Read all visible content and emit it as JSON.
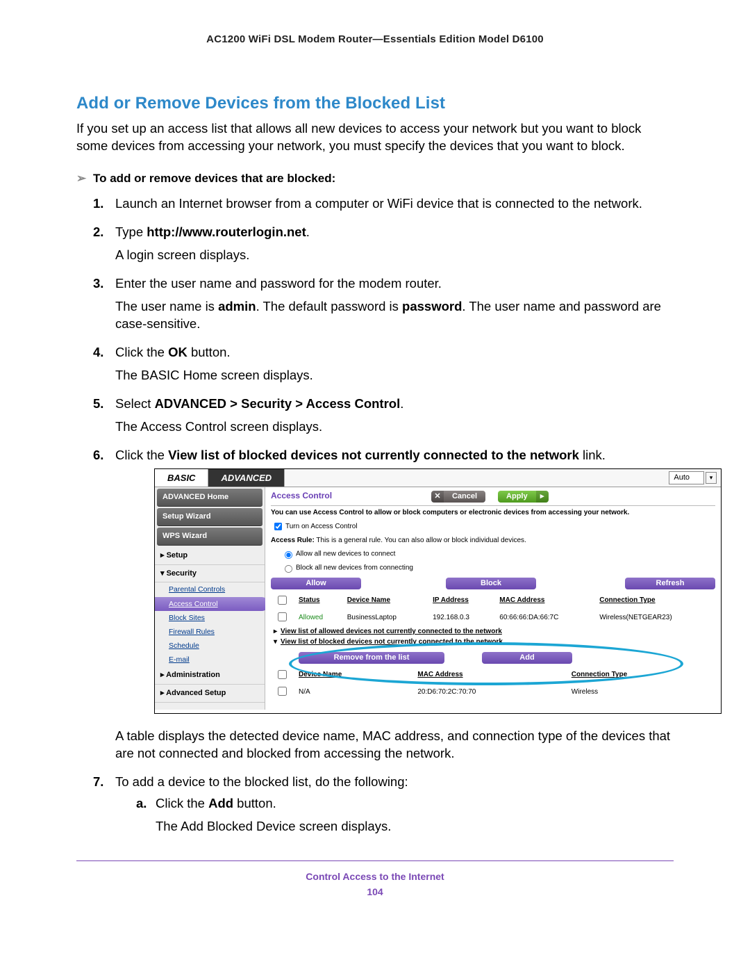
{
  "header": "AC1200 WiFi DSL Modem Router—Essentials Edition Model D6100",
  "section_title": "Add or Remove Devices from the Blocked List",
  "intro": "If you set up an access list that allows all new devices to access your network but you want to block some devices from accessing your network, you must specify the devices that you want to block.",
  "procedure_heading": "To add or remove devices that are blocked:",
  "steps": {
    "s1": "Launch an Internet browser from a computer or WiFi device that is connected to the network.",
    "s2_pre": "Type ",
    "s2_url": "http://www.routerlogin.net",
    "s2_post": ".",
    "s2_sub": "A login screen displays.",
    "s3": "Enter the user name and password for the modem router.",
    "s3_sub_pre": "The user name is ",
    "s3_sub_admin": "admin",
    "s3_sub_mid": ". The default password is ",
    "s3_sub_pw": "password",
    "s3_sub_post": ". The user name and password are case-sensitive.",
    "s4_pre": "Click the ",
    "s4_btn": "OK",
    "s4_post": " button.",
    "s4_sub": "The BASIC Home screen displays.",
    "s5_pre": "Select ",
    "s5_path": "ADVANCED > Security > Access Control",
    "s5_post": ".",
    "s5_sub": "The Access Control screen displays.",
    "s6_pre": "Click the ",
    "s6_link": "View list of blocked devices not currently connected to the network",
    "s6_post": " link.",
    "post_table": "A table displays the detected device name, MAC address, and connection type of the devices that are not connected and blocked from accessing the network.",
    "s7": "To add a device to the blocked list, do the following:",
    "s7a_pre": "Click the ",
    "s7a_btn": "Add",
    "s7a_post": " button.",
    "s7a_sub": "The Add Blocked Device screen displays."
  },
  "shot": {
    "tabs": {
      "basic": "BASIC",
      "advanced": "ADVANCED"
    },
    "lang": "Auto",
    "sidebar": {
      "adv_home": "ADVANCED Home",
      "setup_wizard": "Setup Wizard",
      "wps_wizard": "WPS Wizard",
      "setup": "Setup",
      "security": "Security",
      "subs": [
        "Parental Controls",
        "Access Control",
        "Block Sites",
        "Firewall Rules",
        "Schedule",
        "E-mail"
      ],
      "admin": "Administration",
      "adv_setup": "Advanced Setup"
    },
    "panel": {
      "title": "Access Control",
      "cancel": "Cancel",
      "apply": "Apply",
      "desc": "You can use Access Control to allow or block computers or electronic devices from accessing your network.",
      "turn_on": "Turn on Access Control",
      "rule_label": "Access Rule:",
      "rule_text": " This is a general rule. You can also allow or block individual devices.",
      "radio_allow": "Allow all new devices to connect",
      "radio_block": "Block all new devices from connecting",
      "btn_allow": "Allow",
      "btn_block": "Block",
      "btn_refresh": "Refresh",
      "cols": {
        "status": "Status",
        "name": "Device Name",
        "ip": "IP Address",
        "mac": "MAC Address",
        "conn": "Connection Type"
      },
      "row1": {
        "status": "Allowed",
        "name": "BusinessLaptop",
        "ip": "192.168.0.3",
        "mac": "60:66:66:DA:66:7C",
        "conn": "Wireless(NETGEAR23)"
      },
      "link_allowed": "View list of allowed devices not currently connected to the network",
      "link_blocked": "View list of blocked devices not currently connected to the network",
      "btn_remove": "Remove from the list",
      "btn_add": "Add",
      "cols2": {
        "name": "Device Name",
        "mac": "MAC Address",
        "conn": "Connection Type"
      },
      "row2": {
        "name": "N/A",
        "mac": "20:D6:70:2C:70:70",
        "conn": "Wireless"
      }
    }
  },
  "footer": {
    "chapter": "Control Access to the Internet",
    "page": "104"
  }
}
